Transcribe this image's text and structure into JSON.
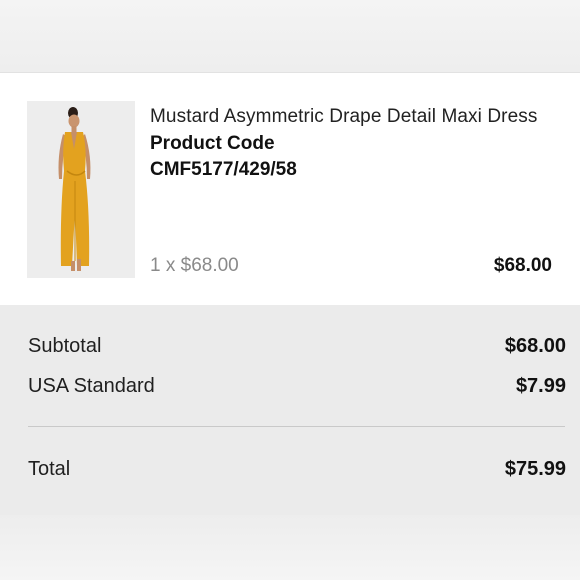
{
  "item": {
    "image_icon": "product-photo",
    "name": "Mustard Asymmetric Drape Detail Maxi Dress",
    "code_label": "Product Code",
    "code_value": "CMF5177/429/58",
    "quantity_price": "1 x $68.00",
    "line_total": "$68.00"
  },
  "summary": {
    "subtotal_label": "Subtotal",
    "subtotal_value": "$68.00",
    "shipping_label": "USA Standard",
    "shipping_value": "$7.99",
    "total_label": "Total",
    "total_value": "$75.99"
  },
  "colors": {
    "dress": "#e3a21f",
    "card_bg": "#ffffff",
    "summary_bg": "#ebebeb"
  }
}
